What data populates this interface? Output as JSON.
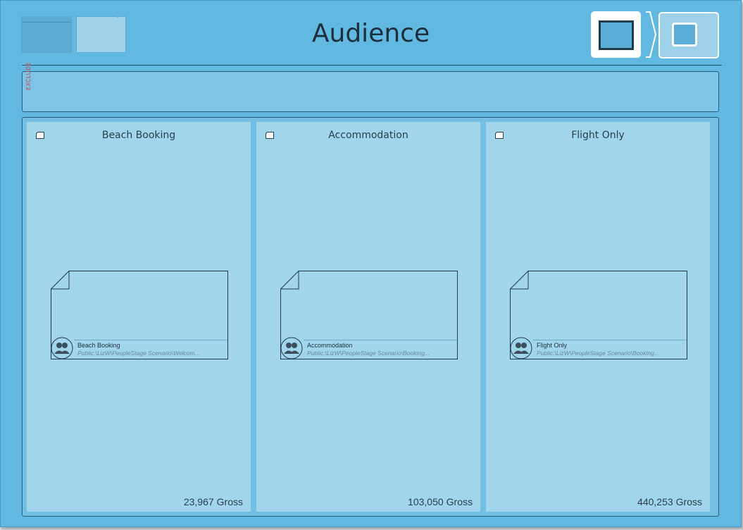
{
  "header": {
    "title": "Audience",
    "thumbnails": [
      "thumbnail-primary",
      "thumbnail-secondary"
    ],
    "view_toggles": [
      "single-view-icon",
      "compact-view-icon"
    ]
  },
  "exclude": {
    "label": "EXCLUDE"
  },
  "segments": [
    {
      "name": "Beach Booking",
      "icon": "folder-icon",
      "card": {
        "title": "Beach Booking",
        "path": "Public:\\LizW\\PeopleStage Scenario\\Welcom...",
        "icon": "people-icon"
      },
      "gross_count": "23,967",
      "gross_label": "Gross"
    },
    {
      "name": "Accommodation",
      "icon": "folder-icon",
      "card": {
        "title": "Accommodation",
        "path": "Public:\\LizW\\PeopleStage Scenario\\Booking...",
        "icon": "people-icon"
      },
      "gross_count": "103,050",
      "gross_label": "Gross"
    },
    {
      "name": "Flight Only",
      "icon": "folder-icon",
      "card": {
        "title": "Flight Only",
        "path": "Public:\\LizW\\PeopleStage Scenario\\Booking...",
        "icon": "people-icon"
      },
      "gross_count": "440,253",
      "gross_label": "Gross"
    }
  ],
  "colors": {
    "background": "#61b8e0",
    "panel": "#a1d5ec",
    "exclude_text": "#d04545",
    "text": "#2b3d4a"
  }
}
